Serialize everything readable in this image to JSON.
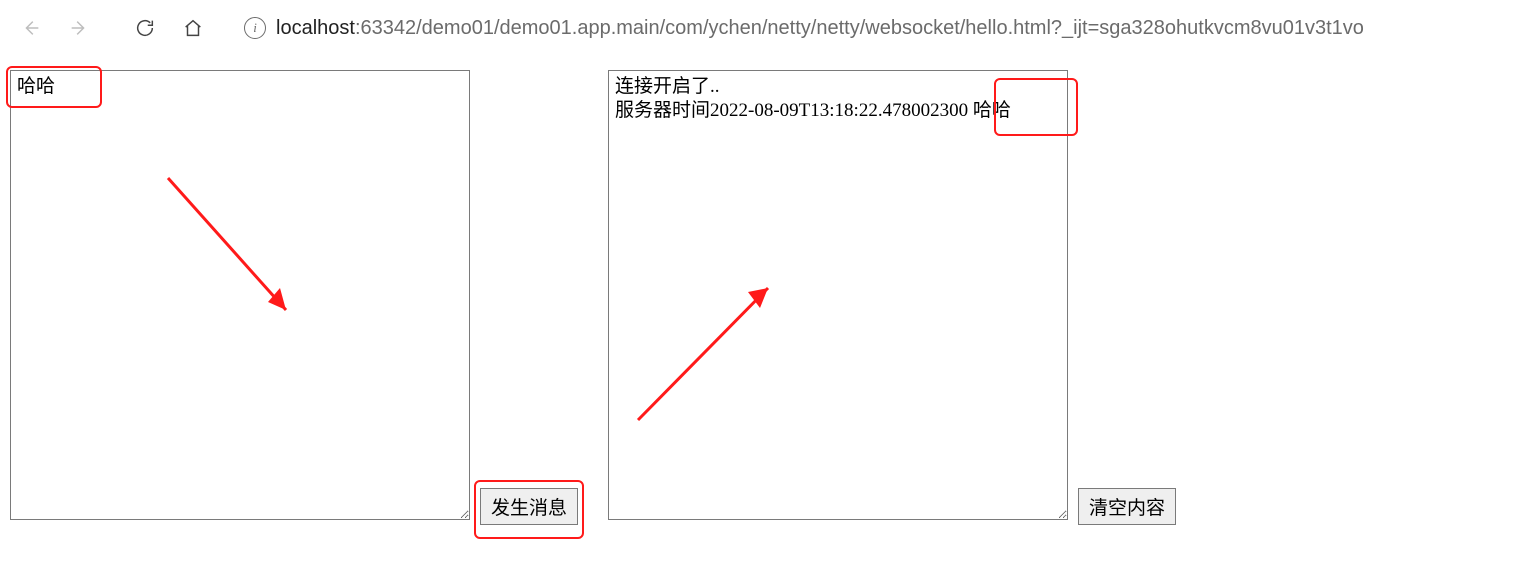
{
  "browser": {
    "url_scheme_host": "localhost",
    "url_rest": ":63342/demo01/demo01.app.main/com/ychen/netty/netty/websocket/hello.html?_ijt=sga328ohutkvcm8vu01v3t1vo"
  },
  "page": {
    "input_value": "哈哈",
    "send_button_label": "发生消息",
    "log_value": "连接开启了..\n服务器时间2022-08-09T13:18:22.478002300 哈哈",
    "clear_button_label": "清空内容"
  }
}
